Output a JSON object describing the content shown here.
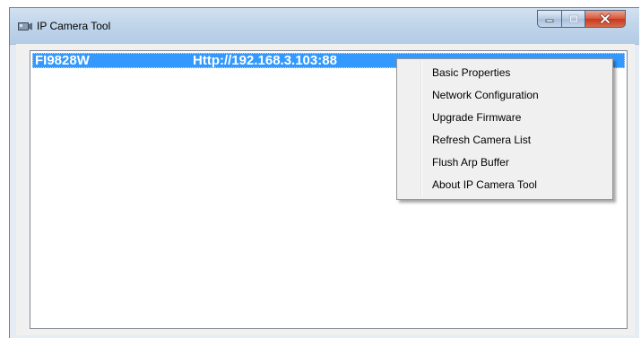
{
  "window": {
    "title": "IP Camera Tool"
  },
  "camera_list": {
    "rows": [
      {
        "name": "FI9828W",
        "url": "Http://192.168.3.103:88",
        "selected": true
      }
    ]
  },
  "context_menu": {
    "items": [
      {
        "label": "Basic Properties"
      },
      {
        "label": "Network Configuration"
      },
      {
        "label": "Upgrade Firmware"
      },
      {
        "label": "Refresh Camera List"
      },
      {
        "label": "Flush Arp Buffer"
      },
      {
        "label": "About IP Camera Tool"
      }
    ]
  },
  "colors": {
    "selection": "#3399ff",
    "close_button": "#c8381c",
    "menu_background": "#f0f0f0"
  }
}
